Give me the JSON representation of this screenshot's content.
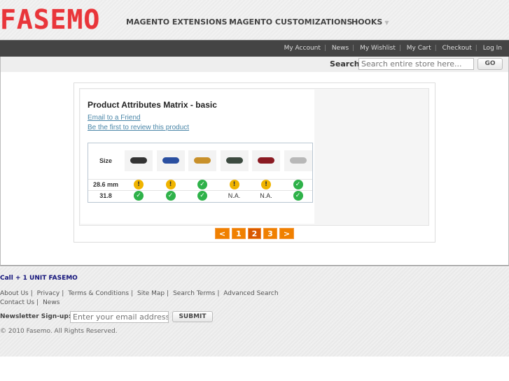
{
  "header": {
    "logo": "FASEMO",
    "nav": [
      "MAGENTO EXTENSIONS",
      "MAGENTO CUSTOMIZATIONS",
      "HOOKS"
    ],
    "caret": "▼"
  },
  "toplinks": [
    "My Account",
    "News",
    "My Wishlist",
    "My Cart",
    "Checkout",
    "Log In"
  ],
  "search": {
    "label": "Search",
    "placeholder": "Search entire store here...",
    "button": "GO"
  },
  "product": {
    "title": "Product Attributes Matrix - basic",
    "email_link": "Email to a Friend",
    "review_link": "Be the first to review this product",
    "matrix": {
      "header": "Size",
      "colors": [
        "#333333",
        "#2a4fa0",
        "#c8902a",
        "#3c4a40",
        "#8a1a22",
        "#b8b8b8"
      ],
      "rows": [
        {
          "label": "28.6 mm",
          "cells": [
            "warn",
            "warn",
            "ok",
            "warn",
            "warn",
            "ok"
          ]
        },
        {
          "label": "31.8",
          "cells": [
            "ok",
            "ok",
            "ok",
            "N.A.",
            "N.A.",
            "ok"
          ]
        }
      ]
    }
  },
  "pagination": {
    "prev": "<",
    "pages": [
      "1",
      "2",
      "3"
    ],
    "current": "2",
    "next": ">"
  },
  "footer": {
    "call": "Call + 1 UNIT FASEMO",
    "links1": [
      "About Us",
      "Privacy",
      "Terms & Conditions",
      "Site Map",
      "Search Terms",
      "Advanced Search"
    ],
    "links2": [
      "Contact Us",
      "News"
    ],
    "newsletter_label": "Newsletter Sign-up:",
    "newsletter_placeholder": "Enter your email address",
    "submit": "SUBMIT",
    "copyright": "© 2010 Fasemo. All Rights Reserved."
  }
}
